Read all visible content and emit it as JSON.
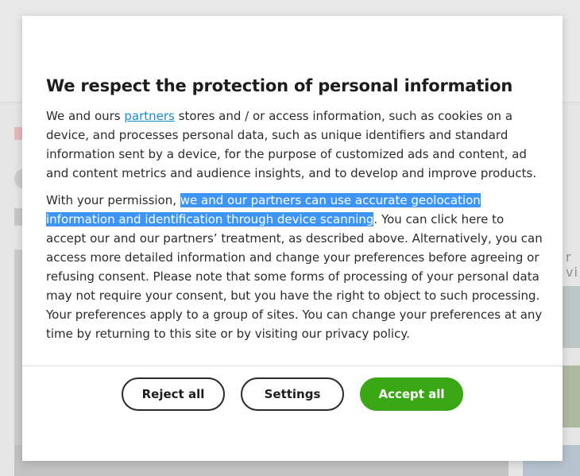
{
  "consent_dialog": {
    "title": "We respect the protection of personal information",
    "paragraph1": {
      "before_link": "We and ours ",
      "link_text": "partners",
      "after_link": " stores and / or access information, such as cookies on a device, and processes personal data, such as unique identifiers and standard information sent by a device, for the purpose of customized ads and content, ad and content metrics and audience insights, and to develop and improve products."
    },
    "paragraph2": {
      "before_highlight": "With your permission, ",
      "highlighted": "we and our partners can use accurate geolocation information and identification through device scanning",
      "after_highlight": ". You can click here to accept our and our partners’ treatment, as described above. Alternatively, you can access more detailed information and change your preferences before agreeing or refusing consent. Please note that some forms of processing of your personal data may not require your consent, but you have the right to object to such processing. Your preferences apply to a group of sites. You can change your preferences at any time by returning to this site or by visiting our privacy policy."
    },
    "buttons": {
      "reject_label": "Reject all",
      "settings_label": "Settings",
      "accept_label": "Accept all"
    }
  },
  "background_page": {
    "side_text": "r vi"
  },
  "colors": {
    "accept_button": "#3aa814",
    "link": "#1a8acb",
    "selection_highlight": "#3d95f7"
  }
}
